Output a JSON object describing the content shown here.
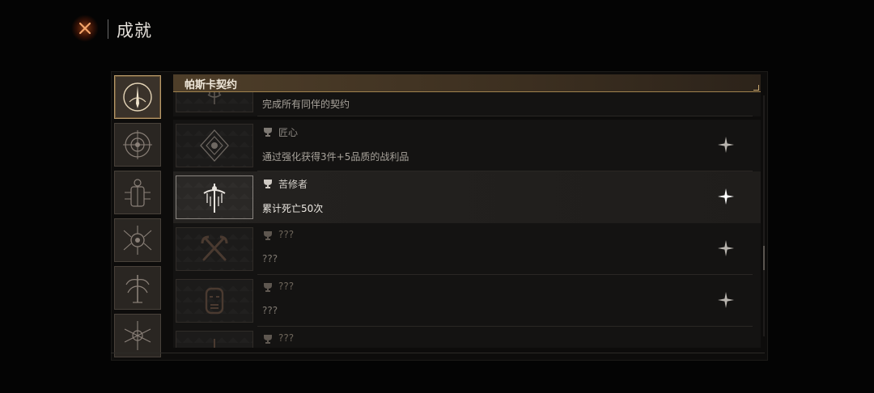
{
  "header": {
    "title": "成就"
  },
  "categories": [
    {
      "name": "compact-sigil",
      "active": true
    },
    {
      "name": "eye-sigil",
      "active": false
    },
    {
      "name": "beetle-sigil",
      "active": false
    },
    {
      "name": "spider-sigil",
      "active": false
    },
    {
      "name": "tree-sigil",
      "active": false
    },
    {
      "name": "thorn-sigil",
      "active": false
    }
  ],
  "category_header": {
    "label": "帕斯卡契约"
  },
  "achievements": [
    {
      "title": "",
      "desc": "完成所有同伴的契约",
      "locked": false,
      "icon": "trident-emblem"
    },
    {
      "title": "匠心",
      "desc": "通过强化获得3件+5品质的战利品",
      "locked": false,
      "icon": "diamond-emblem"
    },
    {
      "title": "苦修者",
      "desc": "累计死亡50次",
      "locked": false,
      "icon": "cross-emblem"
    },
    {
      "title": "???",
      "desc": "???",
      "locked": true,
      "icon": "crossed-axes-emblem"
    },
    {
      "title": "???",
      "desc": "???",
      "locked": true,
      "icon": "mask-emblem"
    },
    {
      "title": "???",
      "desc": "",
      "locked": true,
      "icon": "spire-emblem"
    }
  ],
  "colors": {
    "accent": "#c8a870",
    "locked": "#6d655a",
    "highlight_text": "#ece8e2"
  }
}
